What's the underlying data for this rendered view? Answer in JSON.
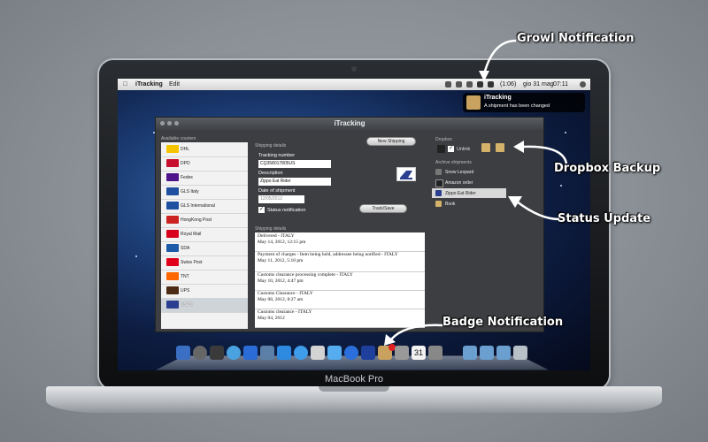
{
  "laptop": {
    "brand": "MacBook Pro"
  },
  "menubar": {
    "app": "iTracking",
    "edit": "Edit",
    "battery": "(1:06)",
    "date": "gio 31 mag",
    "time": "07:11"
  },
  "growl": {
    "title": "iTracking",
    "message": "A shipment has been changed"
  },
  "window": {
    "title": "iTracking",
    "couriers_label": "Available couriers",
    "couriers": [
      "DHL",
      "DPD",
      "Fedex",
      "GLS Italy",
      "GLS International",
      "HongKong Post",
      "Royal Mail",
      "SDA",
      "Swiss Post",
      "TNT",
      "UPS",
      "USPS"
    ],
    "selected_courier": "USPS",
    "details_label": "Shipping details",
    "new_shipping": "New Shipping",
    "tracking_number_label": "Tracking number",
    "tracking_number": "CQ358017805US",
    "description_label": "Description",
    "description": "Zippo Eat Rider",
    "date_label": "Date of shipment",
    "date": "12/05/2012",
    "status_notification": "Status notification",
    "track_save": "Track/Save",
    "events_label": "Shipping details",
    "events": [
      {
        "title": "Delivered - ITALY",
        "date": "May 14, 2012, 12:15 pm"
      },
      {
        "title": "Payment of charges - Item being held, addressee being notified - ITALY",
        "date": "May 11, 2012, 5:10 pm"
      },
      {
        "title": "Customs clearance processing complete - ITALY",
        "date": "May 10, 2012, 4:47 pm"
      },
      {
        "title": "Customs Clearance - ITALY",
        "date": "May 08, 2012, 8:27 am"
      },
      {
        "title": "Customs clearance - ITALY",
        "date": "May 04, 2012"
      }
    ],
    "dropbox_label": "Dropbox",
    "unlink": "Unlink",
    "archive_label": "Archive shipments",
    "archive": [
      "Snow Leopard",
      "Amazon order",
      "Zippo Eat Rider",
      "Book"
    ],
    "selected_archive": "Zippo Eat Rider"
  },
  "annotations": {
    "growl": "Growl Notification",
    "dropbox": "Dropbox Backup",
    "status": "Status Update",
    "badge": "Badge Notification"
  },
  "colors": {
    "background": "#8a9096",
    "window": "#3c3e41",
    "accent": "#f0f0f0"
  }
}
